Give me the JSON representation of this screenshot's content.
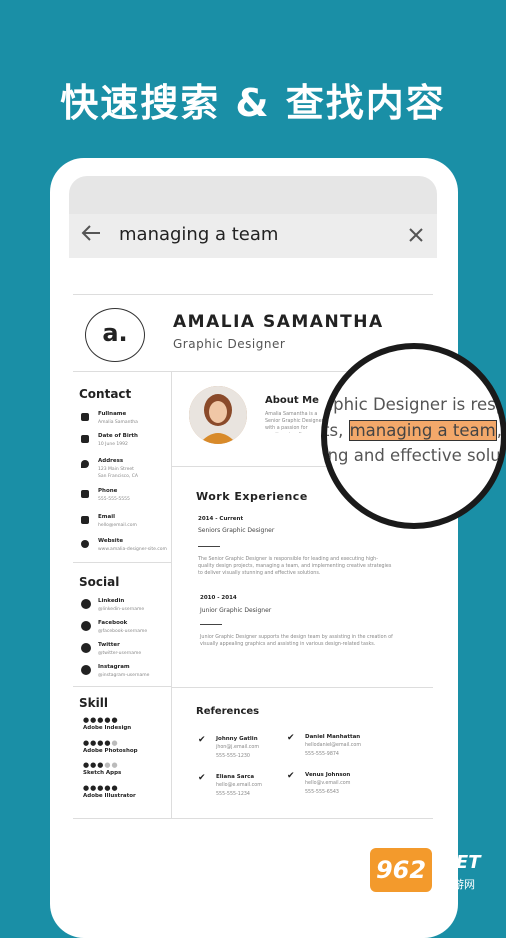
{
  "headline": "快速搜索 & 查找内容",
  "search": {
    "query": "managing a team",
    "back_icon": "arrow-left-icon",
    "close_icon": "close-icon"
  },
  "resume": {
    "logo": "a.",
    "name": "AMALIA SAMANTHA",
    "role": "Graphic Designer",
    "contact": {
      "heading": "Contact",
      "items": [
        {
          "label": "Fullname",
          "value": "Amalia Samantha"
        },
        {
          "label": "Date of Birth",
          "value": "10 June 1992"
        },
        {
          "label": "Address",
          "value": "123 Main Street\nSan Francisco, CA"
        },
        {
          "label": "Phone",
          "value": "555-555-5555"
        },
        {
          "label": "Email",
          "value": "hello@email.com"
        },
        {
          "label": "Website",
          "value": "www.amalia-designer-site.com"
        }
      ]
    },
    "social": {
      "heading": "Social",
      "items": [
        {
          "label": "Linkedin",
          "value": "@linkedin-username"
        },
        {
          "label": "Facebook",
          "value": "@facebook-username"
        },
        {
          "label": "Twitter",
          "value": "@twitter-username"
        },
        {
          "label": "Instagram",
          "value": "@instagram-username"
        }
      ]
    },
    "skill": {
      "heading": "Skill",
      "items": [
        {
          "name": "Adobe Indesign",
          "level": 5
        },
        {
          "name": "Adobe Photoshop",
          "level": 4
        },
        {
          "name": "Sketch Apps",
          "level": 3
        },
        {
          "name": "Adobe Illustrator",
          "level": 5
        }
      ]
    },
    "about": {
      "heading": "About Me",
      "text": "Amalia Samantha is a Senior Graphic Designer with a passion for creating visually stunning designs and leave a lasting impression"
    },
    "experience": {
      "heading": "Work Experience",
      "jobs": [
        {
          "dates": "2014 - Current",
          "title": "Seniors Graphic Designer",
          "desc": "The Senior Graphic Designer is responsible for leading and executing high-quality design projects, managing a team, and implementing creative strategies to deliver visually stunning and effective solutions."
        },
        {
          "dates": "2010 - 2014",
          "title": "Junior Graphic Designer",
          "desc": "Junior Graphic Designer supports the design team by assisting in the creation of visually appealing graphics and assisting in various design-related tasks."
        }
      ]
    },
    "references": {
      "heading": "References",
      "people": [
        {
          "name": "Johnny Gatlin",
          "email": "jhon@j.email.com",
          "phone": "555-555-1230"
        },
        {
          "name": "Daniel Manhattan",
          "email": "hellodaniel@email.com",
          "phone": "555-555-9874"
        },
        {
          "name": "Eliana Sarca",
          "email": "hello@e.email.com",
          "phone": "555-555-1234"
        },
        {
          "name": "Venus Johnson",
          "email": "hello@v.email.com",
          "phone": "555-555-6543"
        }
      ]
    }
  },
  "magnifier": {
    "line1": "aphic Designer is resp",
    "line2_before": "ts, ",
    "line2_highlight": "managing a team",
    "line2_after": ", a",
    "line3": "ing and effective solu"
  },
  "watermark": {
    "number": "962",
    "net": ".NET",
    "sub": "乐游网"
  },
  "colors": {
    "background": "#1a8fa6",
    "highlight": "#f3a86a"
  }
}
